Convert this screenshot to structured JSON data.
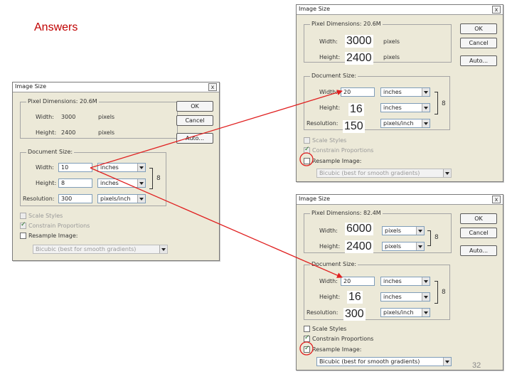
{
  "slide": {
    "title": "Answers",
    "page_number": "32"
  },
  "dialog": {
    "title": "Image Size",
    "close": "x",
    "pixel_dimensions_label": "Pixel Dimensions:",
    "document_size_label": "Document Size:",
    "width_label": "Width:",
    "height_label": "Height:",
    "resolution_label": "Resolution:",
    "ok": "OK",
    "cancel": "Cancel",
    "auto": "Auto...",
    "scale_styles": "Scale Styles",
    "constrain_proportions": "Constrain Proportions",
    "resample_image": "Resample Image:",
    "resample_method": "Bicubic (best for smooth gradients)",
    "unit_pixels": "pixels",
    "unit_inches": "inches",
    "unit_ppi": "pixels/inch",
    "link_icon": "chain-link-icon"
  },
  "left": {
    "pixel_dimensions": "20.6M",
    "px_width": "3000",
    "px_height": "2400",
    "doc_width": "10",
    "doc_height": "8",
    "resolution": "300",
    "scale_styles_checked": false,
    "constrain_checked": true,
    "resample_checked": false
  },
  "top_right": {
    "pixel_dimensions": "20.6M",
    "px_width_answer": "3000",
    "px_height_answer": "2400",
    "doc_width": "20",
    "doc_height_answer": "16",
    "resolution_answer": "150",
    "scale_styles_checked": false,
    "constrain_checked": true,
    "resample_checked": false
  },
  "bottom_right": {
    "pixel_dimensions": "82.4M",
    "px_width_answer": "6000",
    "px_height_answer": "2400",
    "doc_width": "20",
    "doc_height_answer": "16",
    "resolution_answer": "300",
    "scale_styles_checked": false,
    "constrain_checked": true,
    "resample_checked": true
  },
  "colors": {
    "arrow": "#e02020",
    "highlight_circle": "#e02020",
    "title": "#c00000"
  }
}
